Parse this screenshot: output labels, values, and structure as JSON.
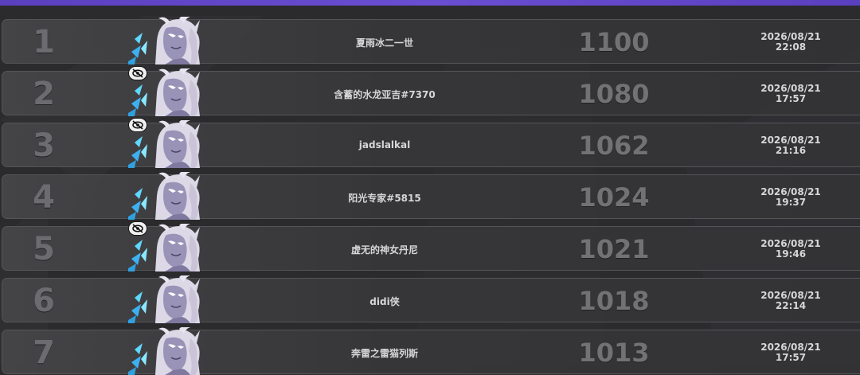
{
  "leaderboard": {
    "rows": [
      {
        "rank": "1",
        "name": "夏雨冰二一世",
        "score": "1100",
        "date": "2026/08/21",
        "time": "22:08",
        "hidden": false
      },
      {
        "rank": "2",
        "name": "含蓄的水龙亚吉#7370",
        "score": "1080",
        "date": "2026/08/21",
        "time": "17:57",
        "hidden": true
      },
      {
        "rank": "3",
        "name": "jadslalkal",
        "score": "1062",
        "date": "2026/08/21",
        "time": "21:16",
        "hidden": true
      },
      {
        "rank": "4",
        "name": "阳光专家#5815",
        "score": "1024",
        "date": "2026/08/21",
        "time": "19:37",
        "hidden": false
      },
      {
        "rank": "5",
        "name": "虚无的神女丹尼",
        "score": "1021",
        "date": "2026/08/21",
        "time": "19:46",
        "hidden": true
      },
      {
        "rank": "6",
        "name": "didi侠",
        "score": "1018",
        "date": "2026/08/21",
        "time": "22:14",
        "hidden": false
      },
      {
        "rank": "7",
        "name": "奔雷之雷猫列斯",
        "score": "1013",
        "date": "2026/08/21",
        "time": "17:57",
        "hidden": false
      }
    ]
  },
  "icons": {
    "hidden_badge": "eye-slash-icon",
    "avatar": "champion-portrait-icon"
  },
  "colors": {
    "accent_bar": "#6a4ed1",
    "background": "#2b2b2d",
    "text": "#d6d6d8",
    "rank_score": "#6c6c70"
  }
}
